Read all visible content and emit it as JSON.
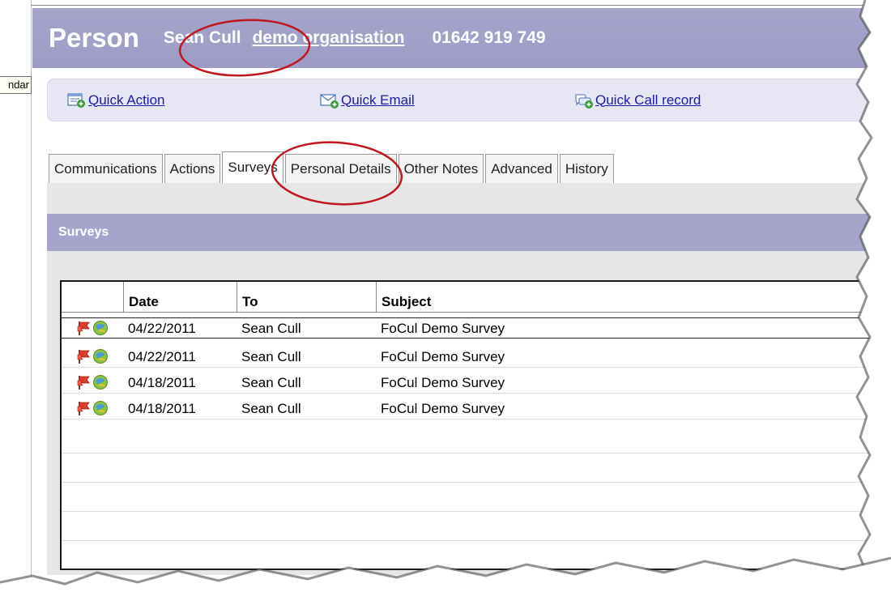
{
  "header": {
    "entity": "Person",
    "name": "Sean Cull",
    "organisation": "demo organisation",
    "phone": "01642 919 749"
  },
  "calendar_tab": {
    "label": "ndar"
  },
  "quick_actions": [
    {
      "label": "Quick Action",
      "icon": "quick-action-icon"
    },
    {
      "label": "Quick Email",
      "icon": "email-icon"
    },
    {
      "label": "Quick Call record",
      "icon": "call-record-icon"
    }
  ],
  "tabs": [
    {
      "label": "Communications"
    },
    {
      "label": "Actions"
    },
    {
      "label": "Surveys",
      "active": true
    },
    {
      "label": "Personal Details"
    },
    {
      "label": "Other Notes"
    },
    {
      "label": "Advanced"
    },
    {
      "label": "History"
    }
  ],
  "section": {
    "title": "Surveys"
  },
  "grid": {
    "columns": [
      "Date",
      "To",
      "Subject"
    ],
    "rows": [
      {
        "date": "04/22/2011",
        "to": "Sean Cull",
        "subject": "FoCul Demo Survey"
      },
      {
        "date": "04/22/2011",
        "to": "Sean Cull",
        "subject": "FoCul Demo Survey"
      },
      {
        "date": "04/18/2011",
        "to": "Sean Cull",
        "subject": "FoCul Demo Survey"
      },
      {
        "date": "04/18/2011",
        "to": "Sean Cull",
        "subject": "FoCul Demo Survey"
      }
    ],
    "row_icons": [
      "flag-icon",
      "survey-globe-icon"
    ]
  },
  "colors": {
    "header_bg": "#a5a4cb",
    "quickbar_bg": "#e7e6f5",
    "link": "#1a1aa6",
    "annotation": "#c0161e"
  }
}
